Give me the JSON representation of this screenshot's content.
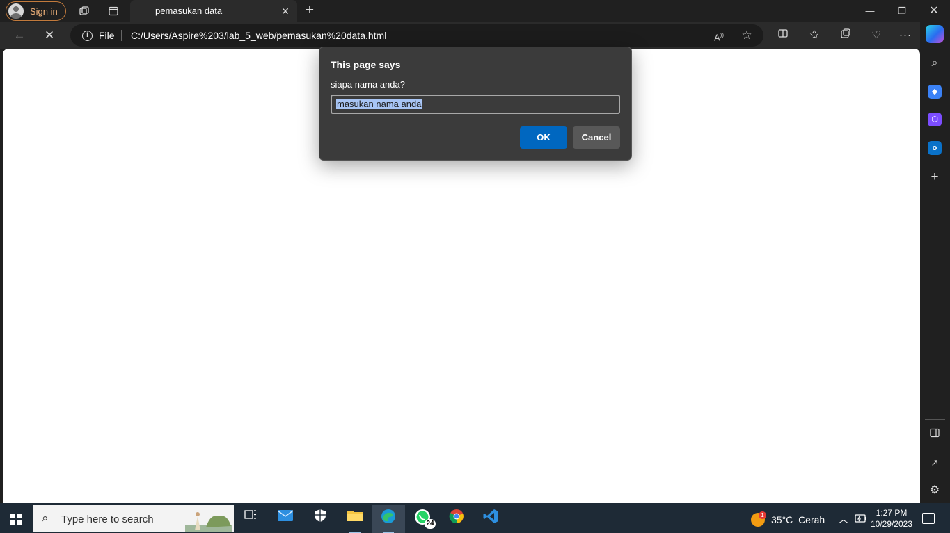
{
  "browser": {
    "signin_label": "Sign in",
    "tab_title": "pemasukan data",
    "address": {
      "protocol_label": "File",
      "url": "C:/Users/Aspire%203/lab_5_web/pemasukan%20data.html"
    }
  },
  "dialog": {
    "title": "This page says",
    "message": "siapa nama anda?",
    "input_value": "masukan nama anda",
    "ok_label": "OK",
    "cancel_label": "Cancel"
  },
  "taskbar": {
    "search_placeholder": "Type here to search",
    "whatsapp_badge": "24",
    "weather": {
      "temperature": "35°C",
      "condition": "Cerah",
      "alert_count": "1"
    },
    "clock": {
      "time": "1:27 PM",
      "date": "10/29/2023"
    }
  },
  "colors": {
    "accent": "#0067c0",
    "dialog_bg": "#3b3b3b",
    "taskbar_bg": "#1e2a36",
    "signin_text": "#f0b27a"
  }
}
